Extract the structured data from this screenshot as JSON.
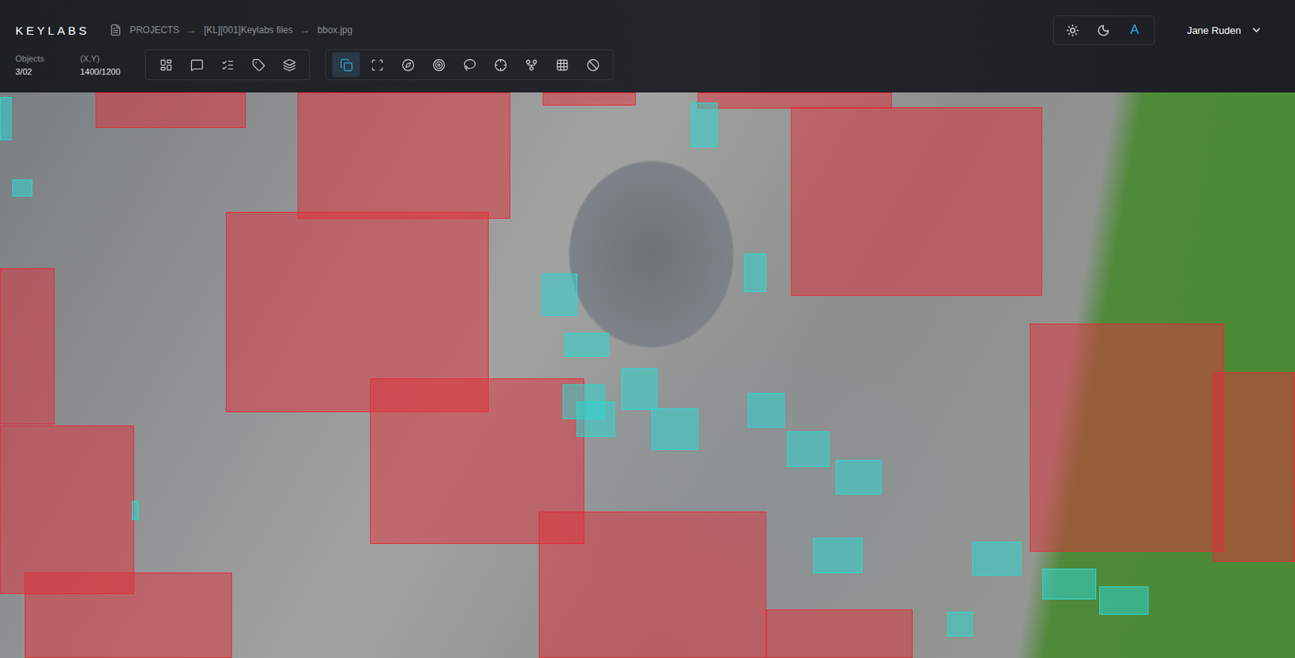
{
  "app": {
    "logo": "KEYLABS"
  },
  "breadcrumb": {
    "items": [
      "PROJECTS",
      "[KL][001]Keylabs files",
      "bbox.jpg"
    ],
    "separator": "→"
  },
  "stats": [
    {
      "label": "Objects",
      "value": "3/02"
    },
    {
      "label": "(X,Y)",
      "value": "1400/1200"
    }
  ],
  "tool_groups": [
    [
      {
        "selected": false
      },
      {
        "selected": false
      },
      {
        "selected": false
      },
      {
        "selected": false
      },
      {
        "selected": false
      }
    ],
    [
      {
        "selected": true
      },
      {
        "selected": false
      },
      {
        "selected": false
      },
      {
        "selected": false
      },
      {
        "selected": false
      },
      {
        "selected": false
      },
      {
        "selected": false
      },
      {
        "selected": false
      },
      {
        "selected": false
      }
    ]
  ],
  "theme_switch": [
    {
      "label": "",
      "selected": false
    },
    {
      "label": "",
      "selected": false
    },
    {
      "label": "A",
      "selected": true
    }
  ],
  "user": {
    "name": "Jane Ruden"
  },
  "annotations": [
    {
      "kind": "building",
      "color": "#e0303a"
    },
    {
      "kind": "building",
      "color": "#e0303a"
    },
    {
      "kind": "building",
      "color": "#e0303a"
    },
    {
      "kind": "building",
      "color": "#e0303a"
    },
    {
      "kind": "building",
      "color": "#e0303a"
    },
    {
      "kind": "building",
      "color": "#e0303a"
    },
    {
      "kind": "building",
      "color": "#e0303a"
    },
    {
      "kind": "building",
      "color": "#e0303a"
    },
    {
      "kind": "building",
      "color": "#e0303a"
    },
    {
      "kind": "building",
      "color": "#e0303a"
    },
    {
      "kind": "building",
      "color": "#e0303a"
    },
    {
      "kind": "building",
      "color": "#e0303a"
    },
    {
      "kind": "building",
      "color": "#e0303a"
    },
    {
      "kind": "building",
      "color": "#e0303a"
    },
    {
      "kind": "car",
      "color": "#2fd6d0"
    },
    {
      "kind": "car",
      "color": "#2fd6d0"
    },
    {
      "kind": "car",
      "color": "#2fd6d0"
    },
    {
      "kind": "car",
      "color": "#2fd6d0"
    },
    {
      "kind": "car",
      "color": "#2fd6d0"
    },
    {
      "kind": "car",
      "color": "#2fd6d0"
    },
    {
      "kind": "car",
      "color": "#2fd6d0"
    },
    {
      "kind": "car",
      "color": "#2fd6d0"
    },
    {
      "kind": "car",
      "color": "#2fd6d0"
    },
    {
      "kind": "car",
      "color": "#2fd6d0"
    },
    {
      "kind": "car",
      "color": "#2fd6d0"
    },
    {
      "kind": "car",
      "color": "#2fd6d0"
    },
    {
      "kind": "car",
      "color": "#2fd6d0"
    },
    {
      "kind": "car",
      "color": "#2fd6d0"
    },
    {
      "kind": "car",
      "color": "#2fd6d0"
    },
    {
      "kind": "car",
      "color": "#2fd6d0"
    },
    {
      "kind": "car",
      "color": "#2fd6d0"
    },
    {
      "kind": "car",
      "color": "#2fd6d0"
    },
    {
      "kind": "car",
      "color": "#2fd6d0"
    }
  ]
}
